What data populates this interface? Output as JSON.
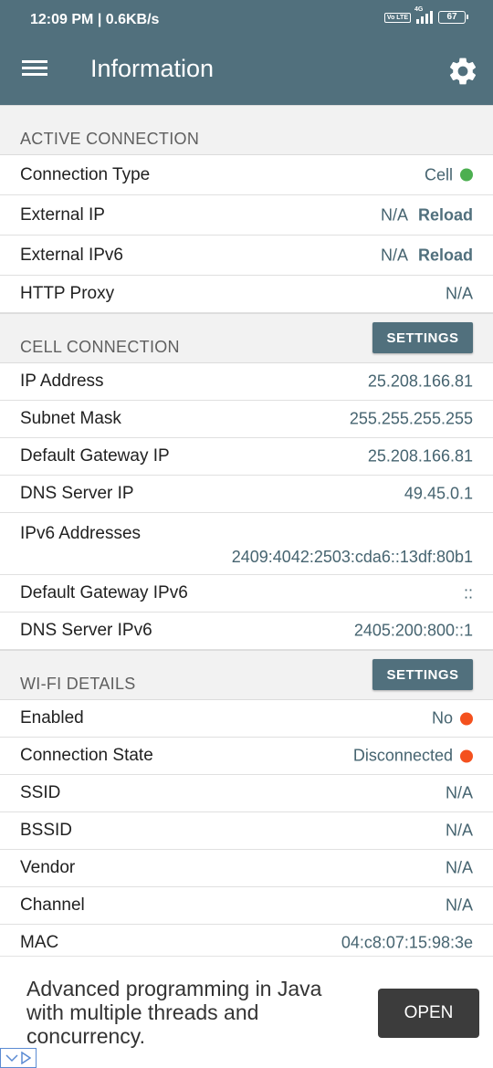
{
  "status_bar": {
    "time_speed": "12:09 PM | 0.6KB/s",
    "volte": "Vo LTE",
    "network": "4G",
    "battery": "67"
  },
  "app_bar": {
    "title": "Information"
  },
  "active_connection": {
    "title": "ACTIVE CONNECTION",
    "rows": [
      {
        "label": "Connection Type",
        "value": "Cell",
        "dot_color": "#4caf50"
      },
      {
        "label": "External IP",
        "value": "N/A",
        "action": "Reload"
      },
      {
        "label": "External IPv6",
        "value": "N/A",
        "action": "Reload"
      },
      {
        "label": "HTTP Proxy",
        "value": "N/A"
      }
    ]
  },
  "cell_connection": {
    "title": "CELL CONNECTION",
    "settings_label": "SETTINGS",
    "rows": [
      {
        "label": "IP Address",
        "value": "25.208.166.81"
      },
      {
        "label": "Subnet Mask",
        "value": "255.255.255.255"
      },
      {
        "label": "Default Gateway IP",
        "value": "25.208.166.81"
      },
      {
        "label": "DNS Server IP",
        "value": "49.45.0.1"
      },
      {
        "label": "IPv6 Addresses",
        "value": "2409:4042:2503:cda6::13df:80b1"
      },
      {
        "label": "Default Gateway IPv6",
        "value": "::"
      },
      {
        "label": "DNS Server IPv6",
        "value": "2405:200:800::1"
      }
    ]
  },
  "wifi_details": {
    "title": "WI-FI DETAILS",
    "settings_label": "SETTINGS",
    "rows": [
      {
        "label": "Enabled",
        "value": "No",
        "dot_color": "#f4511e"
      },
      {
        "label": "Connection State",
        "value": "Disconnected",
        "dot_color": "#f4511e"
      },
      {
        "label": "SSID",
        "value": "N/A"
      },
      {
        "label": "BSSID",
        "value": "N/A"
      },
      {
        "label": "Vendor",
        "value": "N/A"
      },
      {
        "label": "Channel",
        "value": "N/A"
      },
      {
        "label": "MAC",
        "value": "04:c8:07:15:98:3e"
      }
    ]
  },
  "ad": {
    "text": "Advanced programming in Java with multiple threads and concurrency.",
    "button_label": "OPEN"
  },
  "colors": {
    "primary": "#51707d",
    "value_text": "#466470",
    "status_green": "#4caf50",
    "status_orange": "#f4511e"
  }
}
